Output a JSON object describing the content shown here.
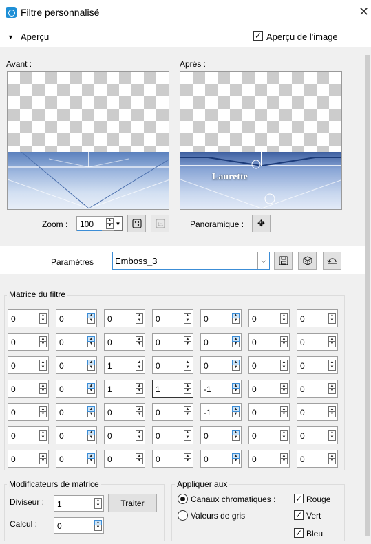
{
  "window": {
    "title": "Filtre personnalisé",
    "close_glyph": "✕"
  },
  "apercu": {
    "label": "Aperçu",
    "toggle_glyph": "▼",
    "image_preview_label": "Aperçu de l'image",
    "image_preview_checked": true
  },
  "preview": {
    "avant_label": "Avant :",
    "apres_label": "Après :",
    "watermark": "Laurette",
    "zoom_label": "Zoom :",
    "zoom_value": "100",
    "pan_label": "Panoramique :"
  },
  "parametres": {
    "label": "Paramètres",
    "preset_value": "Emboss_3"
  },
  "matrix": {
    "title": "Matrice du filtre",
    "rows": [
      [
        "0",
        "0",
        "0",
        "0",
        "0",
        "0",
        "0"
      ],
      [
        "0",
        "0",
        "0",
        "0",
        "0",
        "0",
        "0"
      ],
      [
        "0",
        "0",
        "1",
        "0",
        "0",
        "0",
        "0"
      ],
      [
        "0",
        "0",
        "1",
        "1",
        "-1",
        "0",
        "0"
      ],
      [
        "0",
        "0",
        "0",
        "0",
        "-1",
        "0",
        "0"
      ],
      [
        "0",
        "0",
        "0",
        "0",
        "0",
        "0",
        "0"
      ],
      [
        "0",
        "0",
        "0",
        "0",
        "0",
        "0",
        "0"
      ]
    ]
  },
  "modifiers": {
    "title": "Modificateurs de matrice",
    "diviseur_label": "Diviseur :",
    "diviseur_value": "1",
    "traiter_label": "Traiter",
    "calcul_label": "Calcul :",
    "calcul_value": "0"
  },
  "apply": {
    "title": "Appliquer aux",
    "canaux_label": "Canaux chromatiques :",
    "canaux_selected": true,
    "gris_label": "Valeurs de gris",
    "rouge_label": "Rouge",
    "vert_label": "Vert",
    "bleu_label": "Bleu",
    "check_glyph": "✓"
  }
}
